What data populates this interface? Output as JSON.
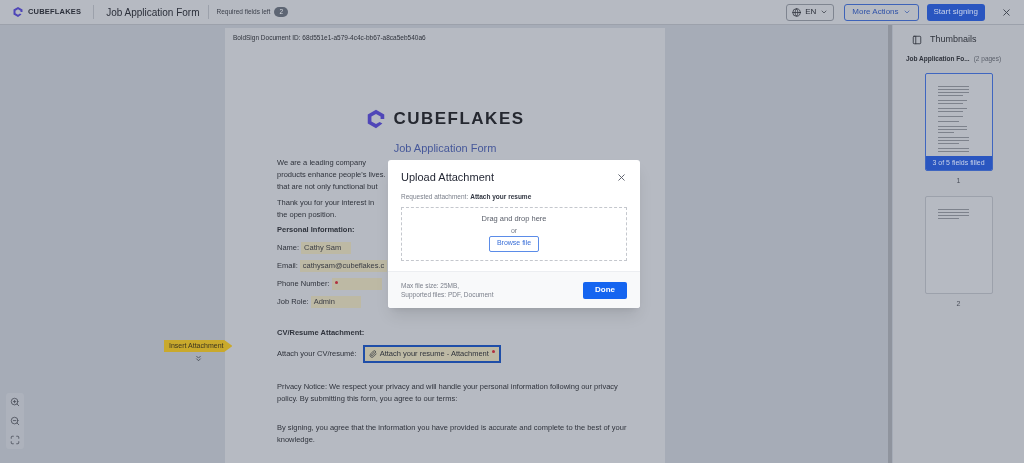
{
  "header": {
    "brand": "CUBEFLAKES",
    "title": "Job Application Form",
    "required_label": "Required fields left",
    "required_count": "2",
    "language": "EN",
    "more_actions": "More Actions",
    "start_signing": "Start signing"
  },
  "document": {
    "doc_id": "BoldSign Document ID: 68d551e1-a579-4c4c-bb67-a8ca5eb540a6",
    "logo_text": "CUBEFLAKES",
    "title": "Job Application Form",
    "intro_lines": [
      "We are a leading company",
      "products enhance people's lives.",
      "that are not only functional but"
    ],
    "thanks_lines": [
      "Thank you for your interest in",
      "the open position."
    ],
    "personal_heading": "Personal Information:",
    "fields": [
      {
        "label": "Name:",
        "value": "Cathy Sam",
        "required": false
      },
      {
        "label": "Email:",
        "value": "cathysam@cubeflakes.c",
        "required": false
      },
      {
        "label": "Phone Number:",
        "required": true
      },
      {
        "label": "Job Role:",
        "value": "Admin",
        "required": false
      }
    ],
    "cv_heading": "CV/Resume Attachment:",
    "cv_label": "Attach your CV/resumé:",
    "cv_field": "Attach your resume - Attachment",
    "cv_required": true,
    "cv_selected": true,
    "privacy": "Privacy Notice: We respect your privacy and will handle your personal information following our privacy policy. By submitting this form, you agree to our terms:",
    "signing": "By signing, you agree that the information you have provided is accurate and complete to the best of your knowledge."
  },
  "insert_tag": "Insert Attachment",
  "thumbnails": {
    "title": "Thumbnails",
    "doc_name": "Job Application Fo...",
    "pages_count": "(2 pages)",
    "pages": [
      {
        "number": "1",
        "selected": true,
        "status": "3 of 5 fields filled"
      },
      {
        "number": "2",
        "selected": false
      }
    ]
  },
  "modal": {
    "title": "Upload Attachment",
    "requested_label": "Requested attachment:",
    "requested_value": "Attach your resume",
    "drop_text": "Drag and drop here",
    "or": "or",
    "browse": "Browse file",
    "max_size": "Max file size: 25MB,",
    "supported": "Supported files: PDF, Document",
    "done": "Done"
  }
}
